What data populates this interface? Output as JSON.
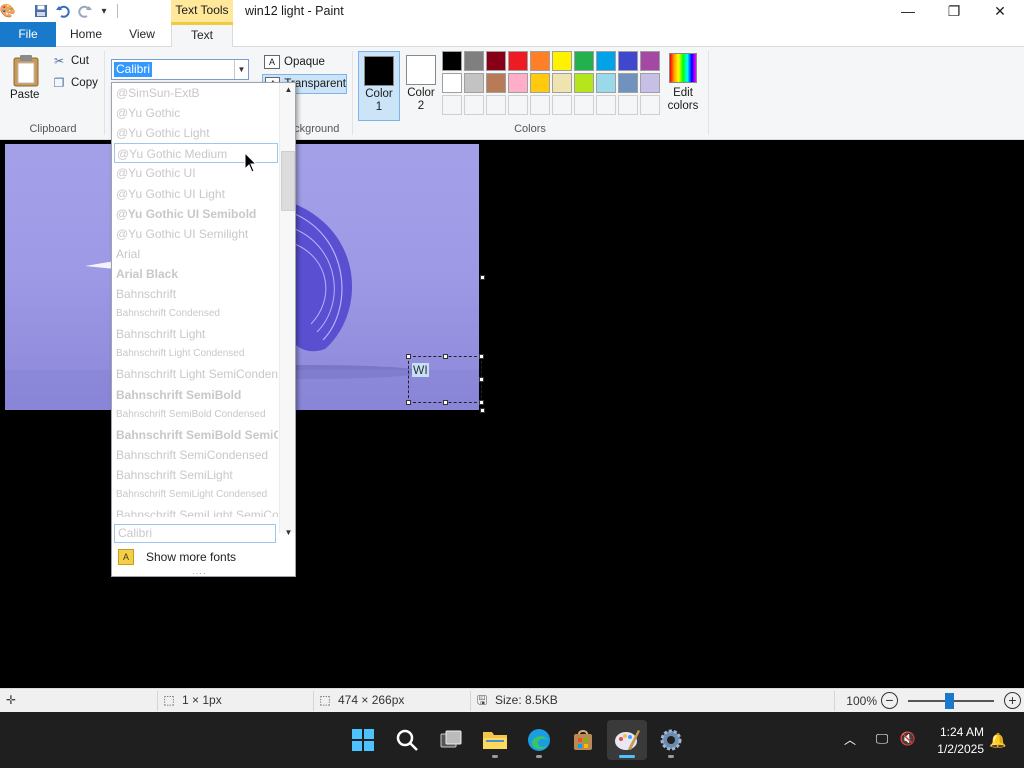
{
  "window": {
    "title": "win12 light - Paint",
    "context_tab": "Text Tools",
    "minimize": "—",
    "maximize": "❐",
    "close": "✕"
  },
  "tabs": {
    "file": "File",
    "home": "Home",
    "view": "View",
    "text": "Text"
  },
  "clipboard": {
    "paste": "Paste",
    "cut": "Cut",
    "copy": "Copy",
    "group_label": "Clipboard"
  },
  "font": {
    "current": "Calibri"
  },
  "background": {
    "opaque": "Opaque",
    "transparent": "Transparent",
    "group_label": "Background"
  },
  "colors": {
    "color1_label": "Color 1",
    "color2_label": "Color 2",
    "color1_value": "#000000",
    "color2_value": "#ffffff",
    "group_label": "Colors",
    "edit_label": "Edit colors",
    "row1": [
      "#000000",
      "#7f7f7f",
      "#880015",
      "#ed1c24",
      "#ff7f27",
      "#fff200",
      "#22b14c",
      "#00a2e8",
      "#3f48cc",
      "#a349a4"
    ],
    "row2": [
      "#ffffff",
      "#c3c3c3",
      "#b97a57",
      "#ffaec9",
      "#ffc90e",
      "#efe4b0",
      "#b5e61d",
      "#99d9ea",
      "#7092be",
      "#c8bfe7"
    ]
  },
  "font_list": [
    {
      "name": "@SimSun-ExtB",
      "style": "normal"
    },
    {
      "name": "@Yu Gothic",
      "style": "normal"
    },
    {
      "name": "@Yu Gothic Light",
      "style": "normal"
    },
    {
      "name": "@Yu Gothic Medium",
      "style": "hover"
    },
    {
      "name": "@Yu Gothic UI",
      "style": "normal"
    },
    {
      "name": "@Yu Gothic UI Light",
      "style": "normal"
    },
    {
      "name": "@Yu Gothic UI Semibold",
      "style": "bold"
    },
    {
      "name": "@Yu Gothic UI Semilight",
      "style": "normal"
    },
    {
      "name": "Arial",
      "style": "normal"
    },
    {
      "name": "Arial Black",
      "style": "bold"
    },
    {
      "name": "Bahnschrift",
      "style": "normal"
    },
    {
      "name": "Bahnschrift Condensed",
      "style": "small"
    },
    {
      "name": "Bahnschrift Light",
      "style": "normal"
    },
    {
      "name": "Bahnschrift Light Condensed",
      "style": "small"
    },
    {
      "name": "Bahnschrift Light SemiCondensed",
      "style": "normal"
    },
    {
      "name": "Bahnschrift SemiBold",
      "style": "bold"
    },
    {
      "name": "Bahnschrift SemiBold Condensed",
      "style": "small"
    },
    {
      "name": "Bahnschrift SemiBold SemiConde",
      "style": "bold"
    },
    {
      "name": "Bahnschrift SemiCondensed",
      "style": "normal"
    },
    {
      "name": "Bahnschrift SemiLight",
      "style": "normal"
    },
    {
      "name": "Bahnschrift SemiLight Condensed",
      "style": "small"
    },
    {
      "name": "Bahnschrift SemiLight SemiConde",
      "style": "normal"
    }
  ],
  "recent_font": "Calibri",
  "show_more_fonts": "Show more fonts",
  "text_box": {
    "value": "WI"
  },
  "status": {
    "selection": "1 × 1px",
    "canvas_size": "474 × 266px",
    "file_size": "Size: 8.5KB",
    "zoom": "100%"
  },
  "taskbar": {
    "time": "1:24 AM",
    "date": "1/2/2025",
    "apps": [
      "start-icon",
      "search-icon",
      "task-view-icon",
      "file-explorer-icon",
      "edge-icon",
      "store-icon",
      "paint-icon",
      "settings-icon"
    ]
  }
}
